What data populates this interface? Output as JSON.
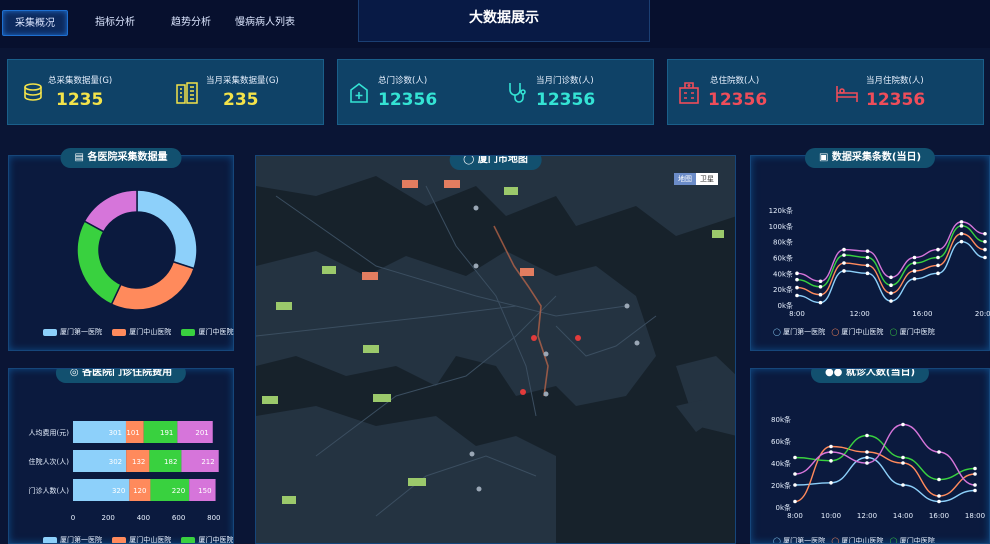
{
  "nav": {
    "tabs": [
      "采集概况",
      "指标分析",
      "趋势分析",
      "慢病病人列表"
    ],
    "title": "大数据展示"
  },
  "stats": [
    {
      "label": "总采集数据量(G)",
      "value": "1235",
      "color": "#f3e34a"
    },
    {
      "label": "当月采集数据量(G)",
      "value": "235",
      "color": "#f3e34a"
    },
    {
      "label": "总门诊数(人)",
      "value": "12356",
      "color": "#34e3d4"
    },
    {
      "label": "当月门诊数(人)",
      "value": "12356",
      "color": "#34e3d4"
    },
    {
      "label": "总住院数(人)",
      "value": "12356",
      "color": "#ef4d5a"
    },
    {
      "label": "当月住院数(人)",
      "value": "12356",
      "color": "#ef4d5a"
    }
  ],
  "panels": {
    "hospital_data": "各医院采集数据量",
    "map": "厦门市地图",
    "collect_count": "数据采集条数(当日)",
    "cost": "各医院门诊住院费用",
    "visits": "就诊人数(当日)"
  },
  "map": {
    "toggle": [
      "地图",
      "卫星"
    ]
  },
  "hospitals": [
    "厦门第一医院",
    "厦门中山医院",
    "厦门中医院"
  ],
  "colors": {
    "h1": "#8dd0fa",
    "h2": "#ff8a5c",
    "h3": "#39d13f",
    "h4": "#d675da"
  },
  "chart_data": [
    {
      "type": "pie",
      "categories": [
        "厦门第一医院",
        "厦门中山医院",
        "厦门中医院",
        ""
      ],
      "values": [
        30,
        27,
        26,
        17
      ]
    },
    {
      "type": "line",
      "x": [
        "8:00",
        "12:00",
        "16:00",
        "20:00"
      ],
      "ylim": [
        0,
        120
      ],
      "yticks": [
        "0k条",
        "20k条",
        "40k条",
        "60k条",
        "80k条",
        "100k条",
        "120k条"
      ],
      "series": [
        {
          "name": "厦门第一医院",
          "values": [
            12,
            3,
            43,
            40,
            5,
            33,
            40,
            80,
            60
          ]
        },
        {
          "name": "厦门中山医院",
          "values": [
            22,
            13,
            53,
            50,
            15,
            43,
            50,
            90,
            70
          ]
        },
        {
          "name": "厦门中医院",
          "values": [
            32,
            23,
            63,
            60,
            25,
            53,
            60,
            100,
            80
          ]
        },
        {
          "name": "",
          "values": [
            40,
            30,
            70,
            68,
            35,
            60,
            70,
            105,
            90
          ]
        }
      ]
    },
    {
      "type": "bar",
      "categories": [
        "人均费用(元)",
        "住院人次(人)",
        "门诊人数(人)"
      ],
      "xlim": [
        0,
        1000
      ],
      "xticks": [
        "0",
        "200",
        "400",
        "600",
        "800",
        "1,000"
      ],
      "series": [
        {
          "name": "厦门第一医院",
          "values": [
            301,
            302,
            320
          ]
        },
        {
          "name": "厦门中山医院",
          "values": [
            101,
            132,
            120
          ]
        },
        {
          "name": "厦门中医院",
          "values": [
            191,
            182,
            220
          ]
        },
        {
          "name": "",
          "values": [
            201,
            212,
            150
          ]
        }
      ]
    },
    {
      "type": "line",
      "x": [
        "8:00",
        "10:00",
        "12:00",
        "14:00",
        "16:00",
        "18:00"
      ],
      "ylim": [
        0,
        80
      ],
      "yticks": [
        "0k条",
        "20k条",
        "40k条",
        "60k条",
        "80k条"
      ],
      "series": [
        {
          "name": "厦门第一医院",
          "values": [
            20,
            22,
            45,
            20,
            5,
            15
          ]
        },
        {
          "name": "厦门中山医院",
          "values": [
            5,
            55,
            50,
            40,
            10,
            30
          ]
        },
        {
          "name": "厦门中医院",
          "values": [
            45,
            42,
            65,
            45,
            25,
            35
          ]
        },
        {
          "name": "",
          "values": [
            30,
            50,
            40,
            75,
            50,
            20
          ]
        }
      ]
    }
  ]
}
